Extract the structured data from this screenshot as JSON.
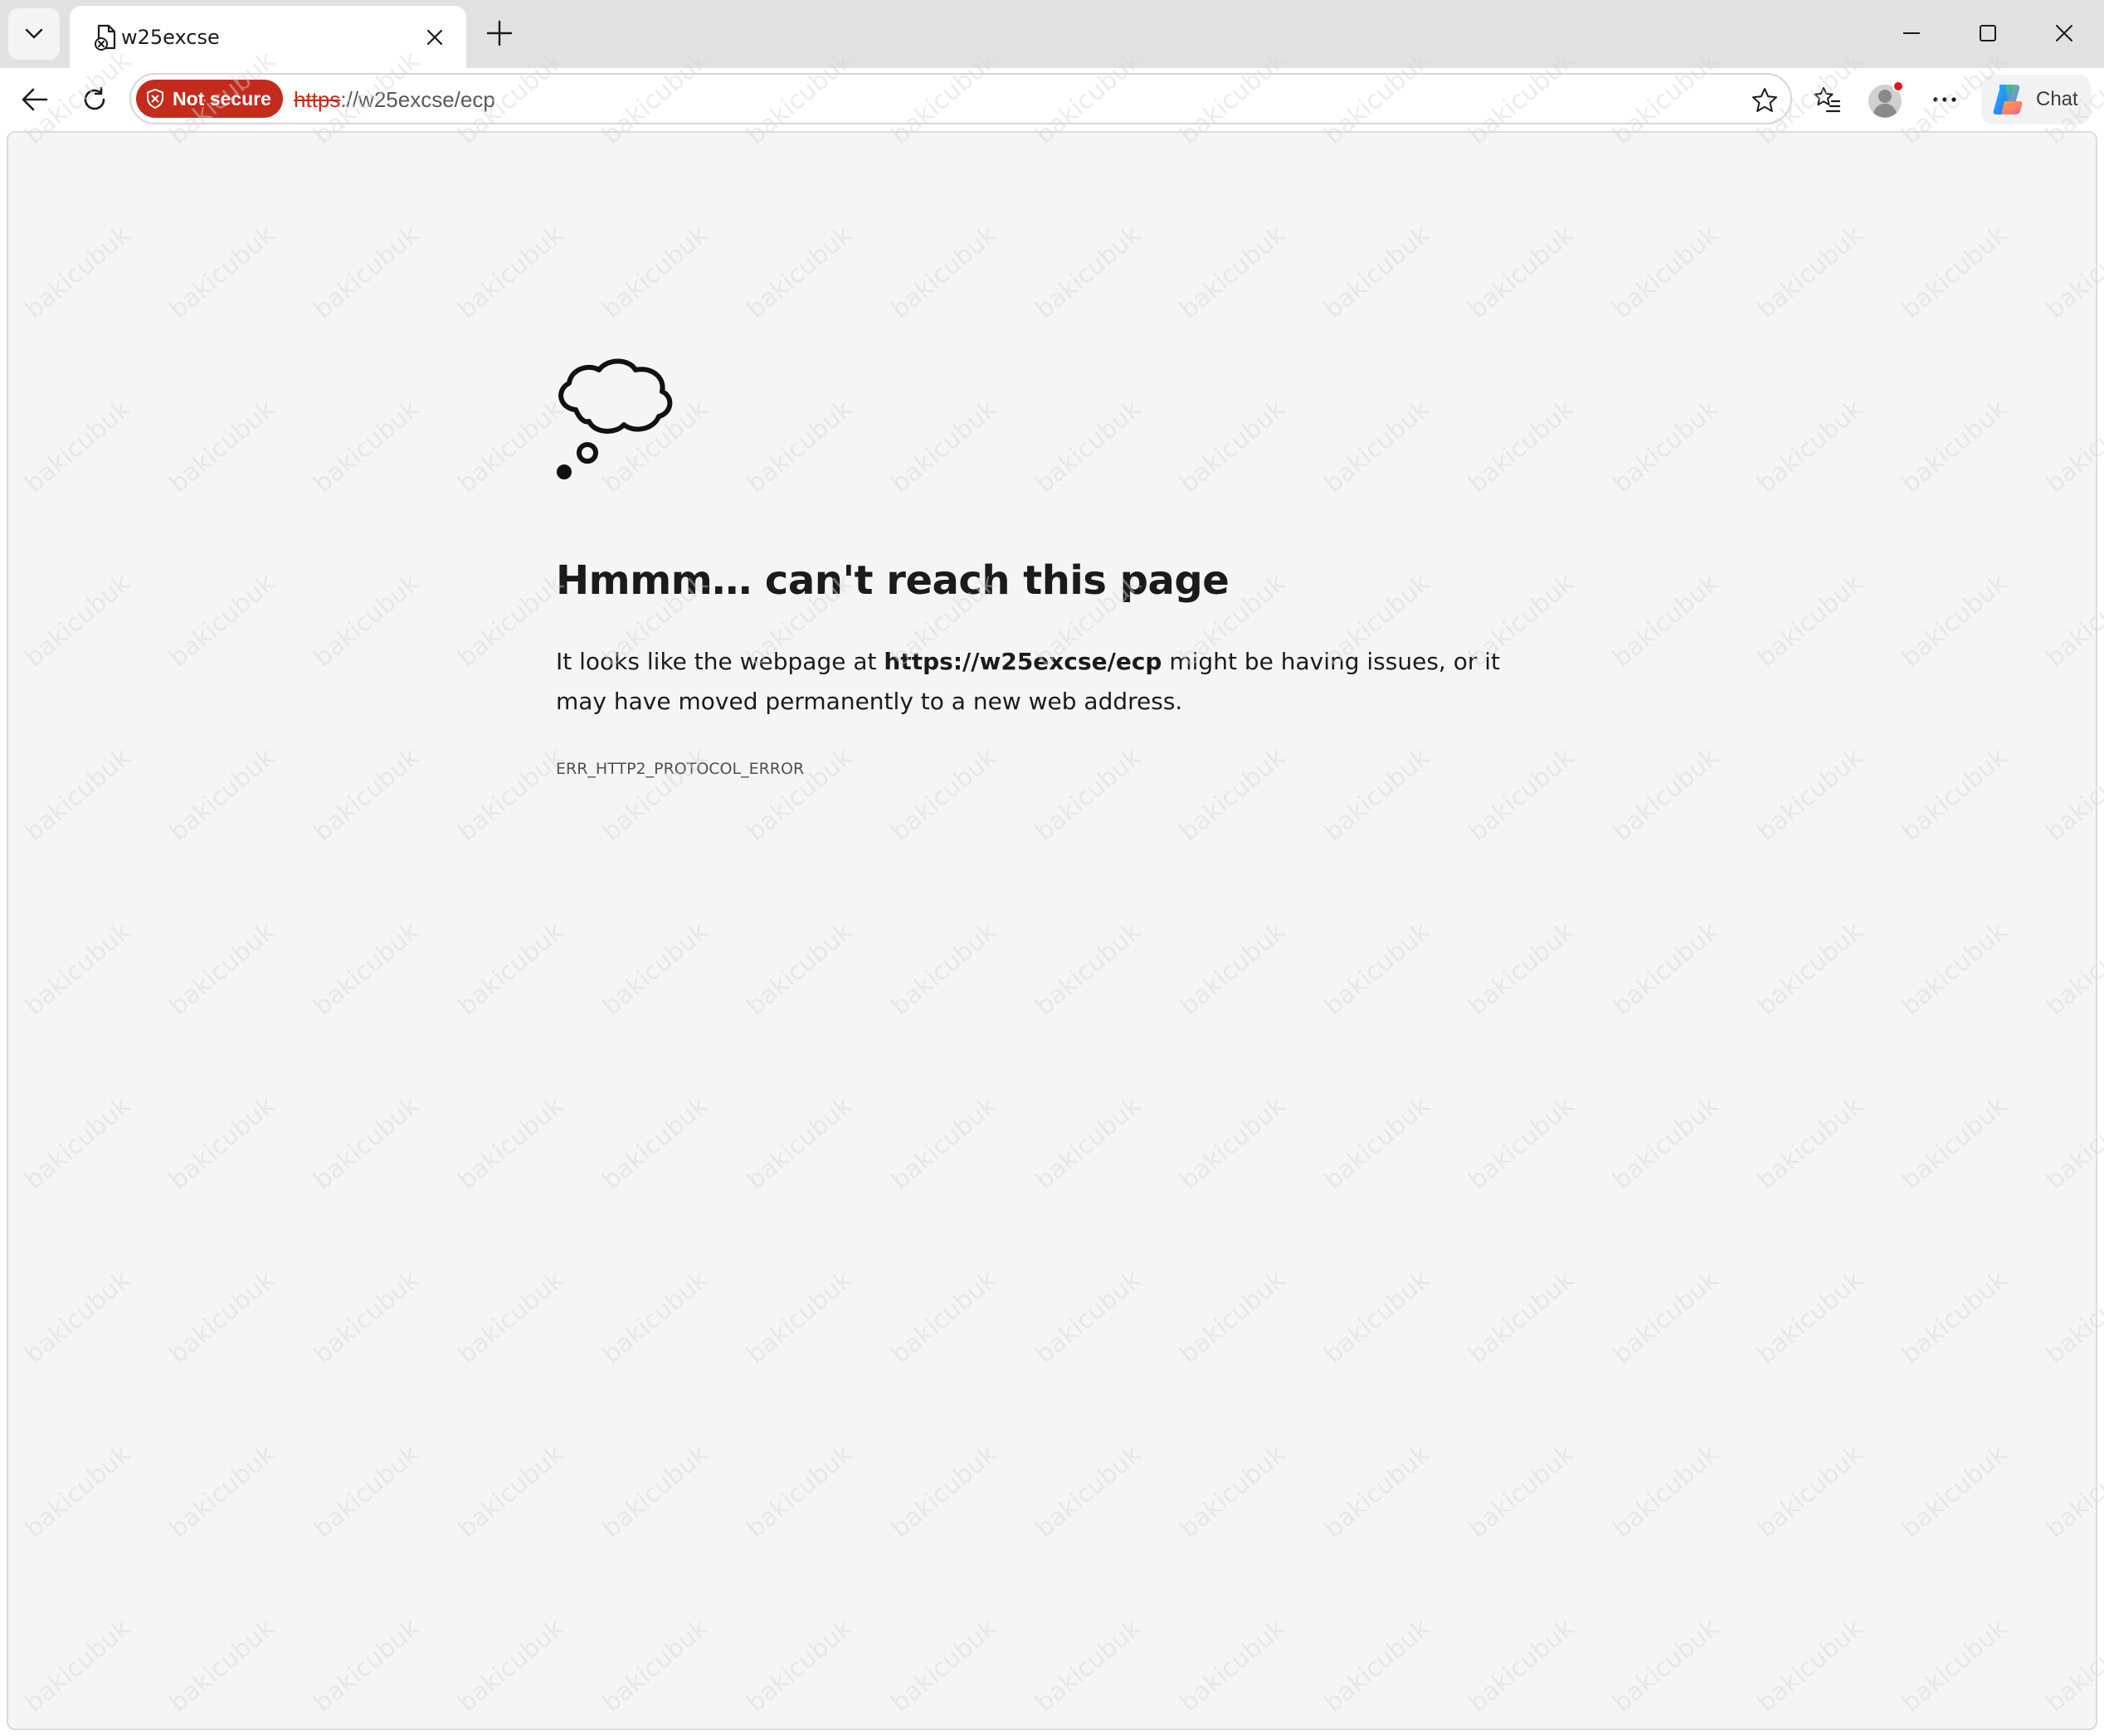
{
  "browser": {
    "tab": {
      "title": "w25excse"
    },
    "address_bar": {
      "security_label": "Not secure",
      "url_scheme": "https",
      "url_rest": "://w25excse/ecp"
    },
    "chat_label": "Chat",
    "profile_badge_color": "#e81123"
  },
  "error_page": {
    "title": "Hmmm… can't reach this page",
    "description_prefix": "It looks like the webpage at ",
    "description_url": "https://w25excse/ecp",
    "description_suffix": " might be having issues, or it may have moved permanently to a new web address.",
    "error_code": "ERR_HTTP2_PROTOCOL_ERROR"
  },
  "watermark": {
    "text": "bakicubuk"
  },
  "colors": {
    "not_secure": "#c42b1c",
    "content_bg": "#f5f5f5",
    "tabstrip_bg": "#e1e1e1"
  }
}
